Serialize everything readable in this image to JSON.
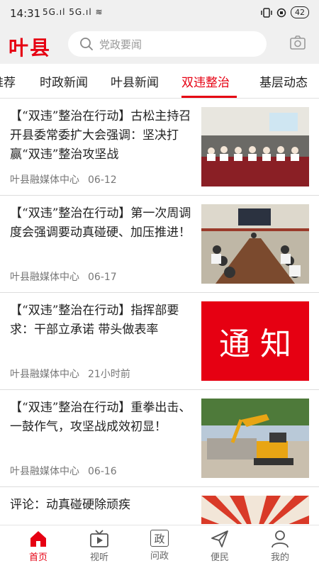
{
  "status": {
    "time": "14:31",
    "signal": "5G.ıl 5G.ıl ≋",
    "battery": "42"
  },
  "header": {
    "logo": "叶县",
    "search_placeholder": "党政要闻"
  },
  "tabs": [
    {
      "label": "推荐"
    },
    {
      "label": "时政新闻"
    },
    {
      "label": "叶县新闻"
    },
    {
      "label": "双违整治",
      "active": true
    },
    {
      "label": "基层动态"
    }
  ],
  "feed": [
    {
      "title": "【“双违”整治在行动】古松主持召开县委常委扩大会强调：坚决打赢“双违”整治攻坚战",
      "source": "叶县融媒体中心",
      "time": "06-12",
      "thumb": "meeting-photo"
    },
    {
      "title": "【“双违”整治在行动】第一次周调度会强调要动真碰硬、加压推进！",
      "source": "叶县融媒体中心",
      "time": "06-17",
      "thumb": "conference-photo"
    },
    {
      "title": "【“双违”整治在行动】指挥部要求：干部立承诺 带头做表率",
      "source": "叶县融媒体中心",
      "time": "21小时前",
      "thumb_text": "通 知"
    },
    {
      "title": "【“双违”整治在行动】重拳出击、一鼓作气，攻坚战成效初显！",
      "source": "叶县融媒体中心",
      "time": "06-16",
      "thumb": "excavator-photo"
    },
    {
      "title": "评论：动真碰硬除顽疾",
      "thumb": "fist-poster"
    }
  ],
  "bottom_nav": [
    {
      "label": "首页",
      "icon": "home-icon",
      "active": true
    },
    {
      "label": "视听",
      "icon": "tv-icon"
    },
    {
      "label": "问政",
      "icon": "zheng-icon",
      "glyph": "政"
    },
    {
      "label": "便民",
      "icon": "send-icon"
    },
    {
      "label": "我的",
      "icon": "user-icon"
    }
  ],
  "colors": {
    "accent": "#e60012",
    "header_bg": "#f0f0f0"
  }
}
